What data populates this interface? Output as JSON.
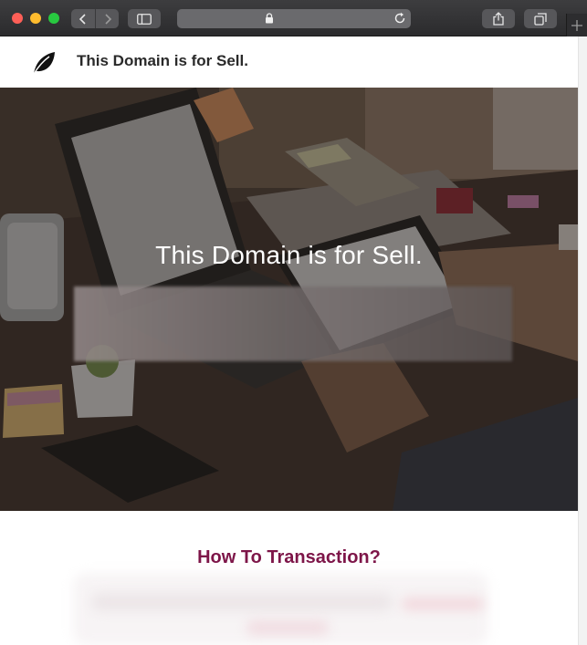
{
  "browser": {
    "icons": {
      "back": "chevron-left-icon",
      "forward": "chevron-right-icon",
      "sidebar": "sidebar-icon",
      "lock": "lock-icon",
      "reload": "reload-icon",
      "share": "share-icon",
      "tabs": "tabs-overview-icon",
      "new_tab": "plus-icon"
    }
  },
  "site": {
    "logo_icon": "leaf-icon",
    "title": "This Domain is for Sell."
  },
  "hero": {
    "title": "This Domain is for Sell."
  },
  "transaction": {
    "title": "How To Transaction?"
  },
  "colors": {
    "accent": "#7d1548",
    "chrome": "#3d3d3f",
    "heading_text": "#2a2a2a"
  }
}
